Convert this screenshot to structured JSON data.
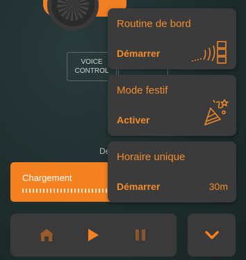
{
  "background": {
    "peek_text": "De"
  },
  "mower_controls": {
    "voice_control_label": "VOICE\nCONTROL"
  },
  "status": {
    "charging_label": "Chargement"
  },
  "menu": {
    "items": [
      {
        "title": "Routine de bord",
        "action": "Démarrer",
        "icon": "wire-signal-icon"
      },
      {
        "title": "Mode festif",
        "action": "Activer",
        "icon": "party-popper-icon"
      },
      {
        "title": "Horaire unique",
        "action": "Démarrer",
        "value": "30m",
        "icon": ""
      }
    ]
  },
  "bottom_bar": {
    "icons": [
      "home-icon",
      "play-icon",
      "pause-icon"
    ],
    "expand_icon": "chevron-down-icon"
  },
  "colors": {
    "accent": "#f28c2c",
    "card_bg": "#3b3b3b",
    "app_bg": "#1f2e2e"
  }
}
